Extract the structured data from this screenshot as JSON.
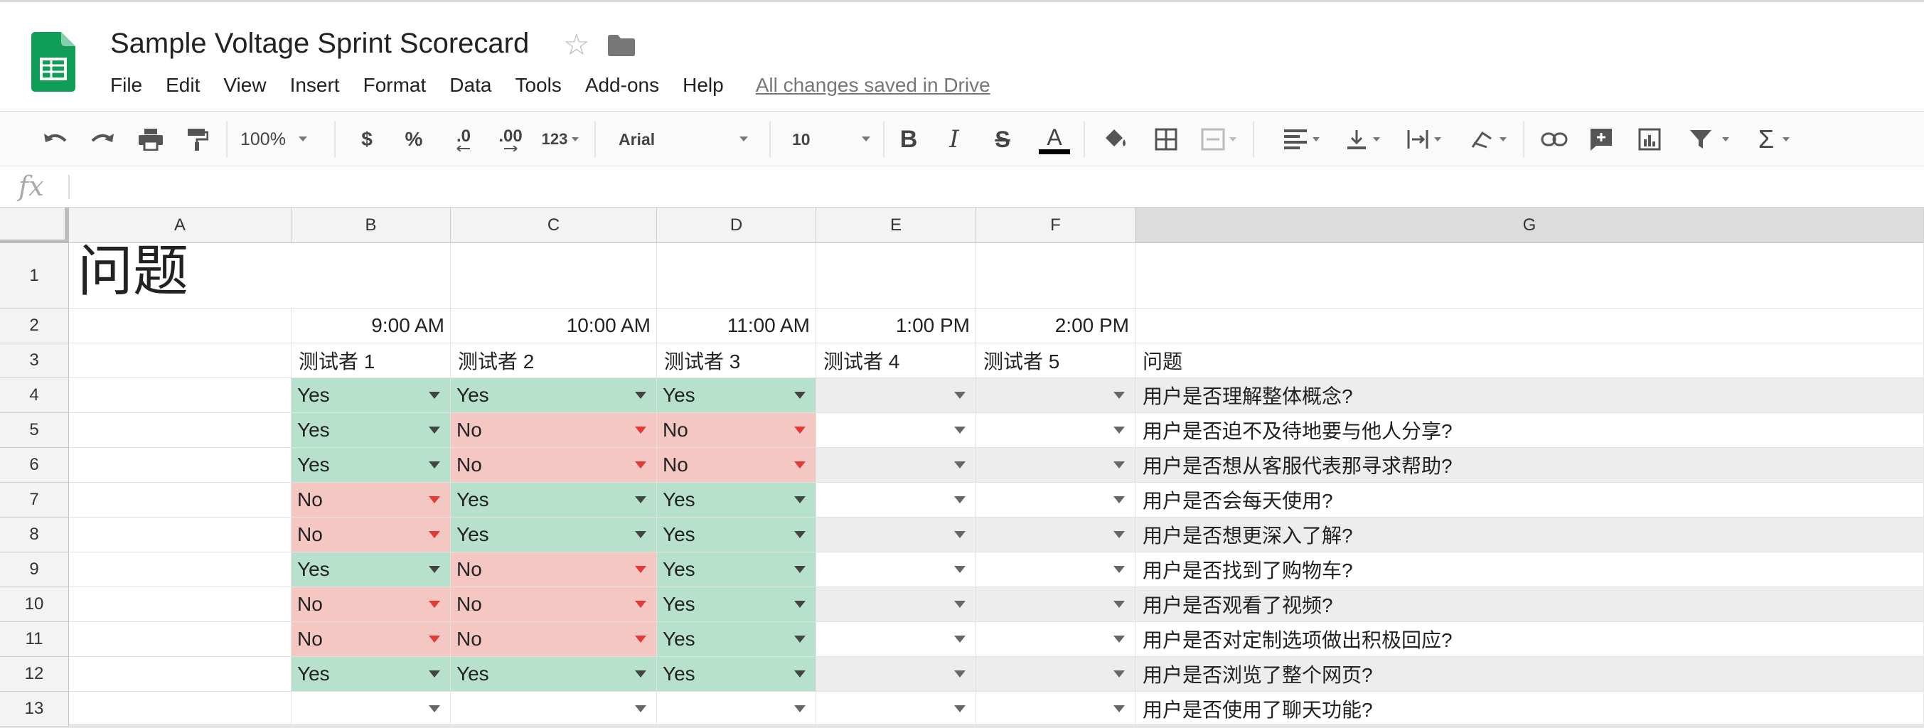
{
  "app": {
    "title": "Sample Voltage Sprint Scorecard",
    "menu": [
      "File",
      "Edit",
      "View",
      "Insert",
      "Format",
      "Data",
      "Tools",
      "Add-ons",
      "Help"
    ],
    "save_status": "All changes saved in Drive"
  },
  "toolbar": {
    "zoom": "100%",
    "currency": "$",
    "percent": "%",
    "decrease_decimals": ".0",
    "increase_decimals": ".00",
    "more_formats": "123",
    "font": "Arial",
    "font_size": "10"
  },
  "formula_bar": {
    "label": "fx",
    "value": ""
  },
  "columns": [
    "A",
    "B",
    "C",
    "D",
    "E",
    "F",
    "G"
  ],
  "rows": [
    "1",
    "2",
    "3",
    "4",
    "5",
    "6",
    "7",
    "8",
    "9",
    "10",
    "11",
    "12",
    "13"
  ],
  "sheet": {
    "title": "问题",
    "times": [
      "9:00 AM",
      "10:00 AM",
      "11:00 AM",
      "1:00 PM",
      "2:00 PM"
    ],
    "testers": [
      "测试者 1",
      "测试者 2",
      "测试者 3",
      "测试者 4",
      "测试者 5"
    ],
    "questions_header": "问题",
    "responses": [
      [
        "Yes",
        "Yes",
        "Yes",
        "",
        ""
      ],
      [
        "Yes",
        "No",
        "No",
        "",
        ""
      ],
      [
        "Yes",
        "No",
        "No",
        "",
        ""
      ],
      [
        "No",
        "Yes",
        "Yes",
        "",
        ""
      ],
      [
        "No",
        "Yes",
        "Yes",
        "",
        ""
      ],
      [
        "Yes",
        "No",
        "Yes",
        "",
        ""
      ],
      [
        "No",
        "No",
        "Yes",
        "",
        ""
      ],
      [
        "No",
        "No",
        "Yes",
        "",
        ""
      ],
      [
        "Yes",
        "Yes",
        "Yes",
        "",
        ""
      ],
      [
        "",
        "",
        "",
        "",
        ""
      ]
    ],
    "questions": [
      "用户是否理解整体概念?",
      "用户是否迫不及待地要与他人分享?",
      "用户是否想从客服代表那寻求帮助?",
      "用户是否会每天使用?",
      "用户是否想更深入了解?",
      "用户是否找到了购物车?",
      "用户是否观看了视频?",
      "用户是否对定制选项做出积极回应?",
      "用户是否浏览了整个网页?",
      "用户是否使用了聊天功能?"
    ]
  },
  "colors": {
    "yes": "#b7e1cd",
    "no": "#f4c7c3",
    "sheets_green": "#0f9d58"
  }
}
